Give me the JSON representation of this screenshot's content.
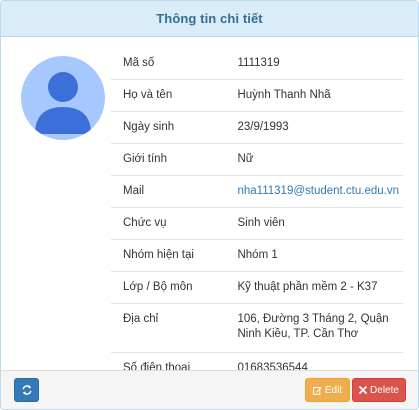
{
  "panel": {
    "title": "Thông tin chi tiết"
  },
  "avatar": {
    "icon": "user-avatar-icon",
    "colors": {
      "background": "#a7c7ff",
      "figure": "#3d6fd9"
    }
  },
  "details": [
    {
      "label": "Mã số",
      "value": "1111319"
    },
    {
      "label": "Họ và tên",
      "value": "Huỳnh Thanh Nhã"
    },
    {
      "label": "Ngày sinh",
      "value": "23/9/1993"
    },
    {
      "label": "Giới tính",
      "value": "Nữ"
    },
    {
      "label": "Mail",
      "value": "nha111319@student.ctu.edu.vn"
    },
    {
      "label": "Chức vụ",
      "value": "Sinh viên"
    },
    {
      "label": "Nhóm hiện tại",
      "value": "Nhóm 1"
    },
    {
      "label": "Lớp / Bộ môn",
      "value": "Kỹ thuật phần mềm 2 - K37"
    },
    {
      "label": "Địa chỉ",
      "value": "106, Đường 3 Tháng 2, Quận Ninh Kiều, TP. Cần Thơ"
    },
    {
      "label": "Số điện thoại",
      "value": "01683536544"
    }
  ],
  "footer": {
    "refresh_icon": "refresh-icon",
    "edit_label": "Edit",
    "edit_icon": "edit-icon",
    "delete_label": "Delete",
    "delete_icon": "delete-icon"
  },
  "colors": {
    "header_bg": "#d9ecf8",
    "title": "#31708f",
    "link": "#337ab7",
    "primary": "#337ab7",
    "warning": "#f0ad4e",
    "danger": "#d9534f"
  }
}
